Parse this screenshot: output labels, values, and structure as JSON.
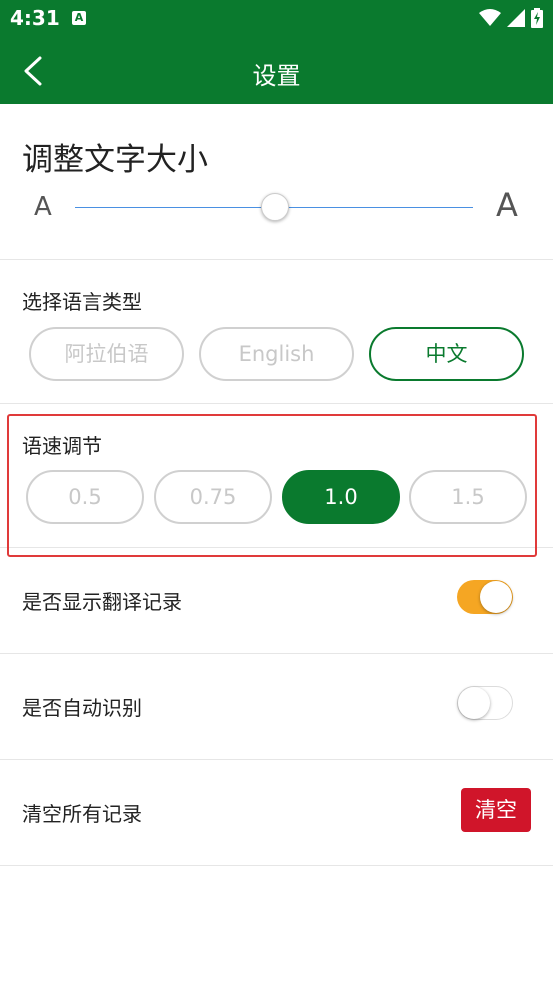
{
  "status_bar": {
    "time": "4:31",
    "notification_icon": "accessibility-a-icon",
    "icons": [
      "wifi-icon",
      "signal-icon",
      "battery-charging-icon"
    ]
  },
  "app_bar": {
    "title": "设置",
    "back_icon": "chevron-left-icon"
  },
  "font_size": {
    "title": "调整文字大小",
    "small_label": "A",
    "large_label": "A",
    "slider_value": 0.5
  },
  "language": {
    "label": "选择语言类型",
    "options": [
      "阿拉伯语",
      "English",
      "中文"
    ],
    "selected": "中文"
  },
  "speech_rate": {
    "label": "语速调节",
    "options": [
      "0.5",
      "0.75",
      "1.0",
      "1.5"
    ],
    "selected": "1.0"
  },
  "settings": {
    "show_history_label": "是否显示翻译记录",
    "show_history_on": true,
    "auto_detect_label": "是否自动识别",
    "auto_detect_on": false,
    "clear_label": "清空所有记录",
    "clear_button": "清空"
  },
  "colors": {
    "brand_green": "#0a7a2e",
    "toggle_on": "#f5a623",
    "danger_red": "#d0152a",
    "highlight_red": "#e03a3a"
  }
}
